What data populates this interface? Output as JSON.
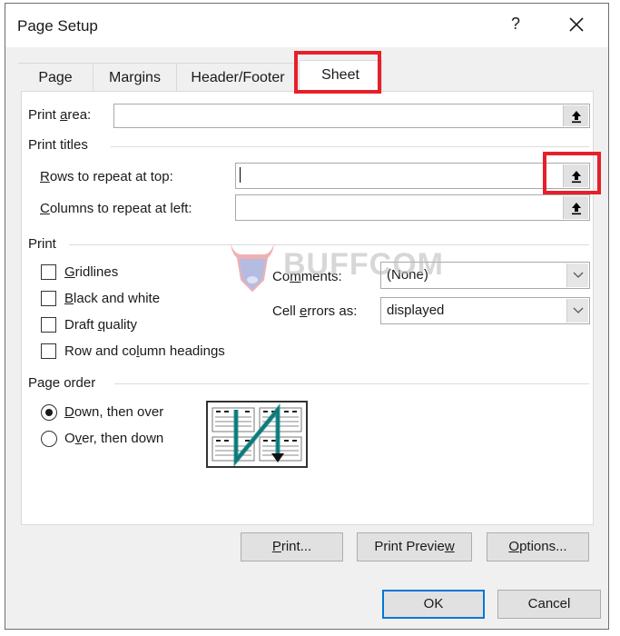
{
  "dialog": {
    "title": "Page Setup",
    "help_label": "?",
    "close_icon": "close-icon"
  },
  "tabs": [
    {
      "label": "Page",
      "active": false
    },
    {
      "label": "Margins",
      "active": false
    },
    {
      "label": "Header/Footer",
      "active": false
    },
    {
      "label": "Sheet",
      "active": true
    }
  ],
  "sheet": {
    "print_area": {
      "label_pre": "Print ",
      "label_ul": "a",
      "label_post": "rea:",
      "value": "",
      "button_icon": "collapse-dialog-icon"
    },
    "print_titles": {
      "heading": "Print titles",
      "rows_to_repeat": {
        "label_pre": "",
        "label_ul": "R",
        "label_post": "ows to repeat at top:",
        "value": "",
        "button_icon": "collapse-dialog-icon"
      },
      "columns_to_repeat": {
        "label_pre": "",
        "label_ul": "C",
        "label_post": "olumns to repeat at left:",
        "value": "",
        "button_icon": "collapse-dialog-icon"
      }
    },
    "print": {
      "heading": "Print",
      "options": [
        {
          "label_pre": "",
          "label_ul": "G",
          "label_post": "ridlines",
          "checked": false
        },
        {
          "label_pre": "",
          "label_ul": "B",
          "label_post": "lack and white",
          "checked": false
        },
        {
          "label_pre": "Draft ",
          "label_ul": "q",
          "label_post": "uality",
          "checked": false
        },
        {
          "label_pre": "Row and co",
          "label_ul": "l",
          "label_post": "umn headings",
          "checked": false
        }
      ],
      "comments": {
        "label_pre": "Co",
        "label_ul": "m",
        "label_post": "ments:",
        "value": "(None)"
      },
      "cell_errors": {
        "label_pre": "Cell ",
        "label_ul": "e",
        "label_post": "rrors as:",
        "value": "displayed"
      }
    },
    "page_order": {
      "heading": "Page order",
      "options": [
        {
          "label_pre": "",
          "label_ul": "D",
          "label_post": "own, then over",
          "selected": true
        },
        {
          "label_pre": "O",
          "label_ul": "v",
          "label_post": "er, then down",
          "selected": false
        }
      ],
      "diagram_icon": "page-order-diagram"
    },
    "buttons": {
      "print": {
        "label_pre": "",
        "label_ul": "P",
        "label_post": "rint..."
      },
      "print_preview": {
        "label_pre": "Print Previe",
        "label_ul": "w",
        "label_post": ""
      },
      "options": {
        "label_pre": "",
        "label_ul": "O",
        "label_post": "ptions..."
      }
    }
  },
  "footer": {
    "ok_label": "OK",
    "cancel_label": "Cancel"
  },
  "annotations": {
    "highlight_color": "#e5202a",
    "highlighted": [
      "tab-sheet",
      "rows-to-repeat-collapse-button"
    ]
  },
  "watermark": {
    "text": "BUFFCOM"
  },
  "colors": {
    "dialog_bg": "#f0f0f0",
    "panel_bg": "#ffffff",
    "default_button_border": "#0078d7",
    "diagram_arrow": "#0f8a8a"
  }
}
